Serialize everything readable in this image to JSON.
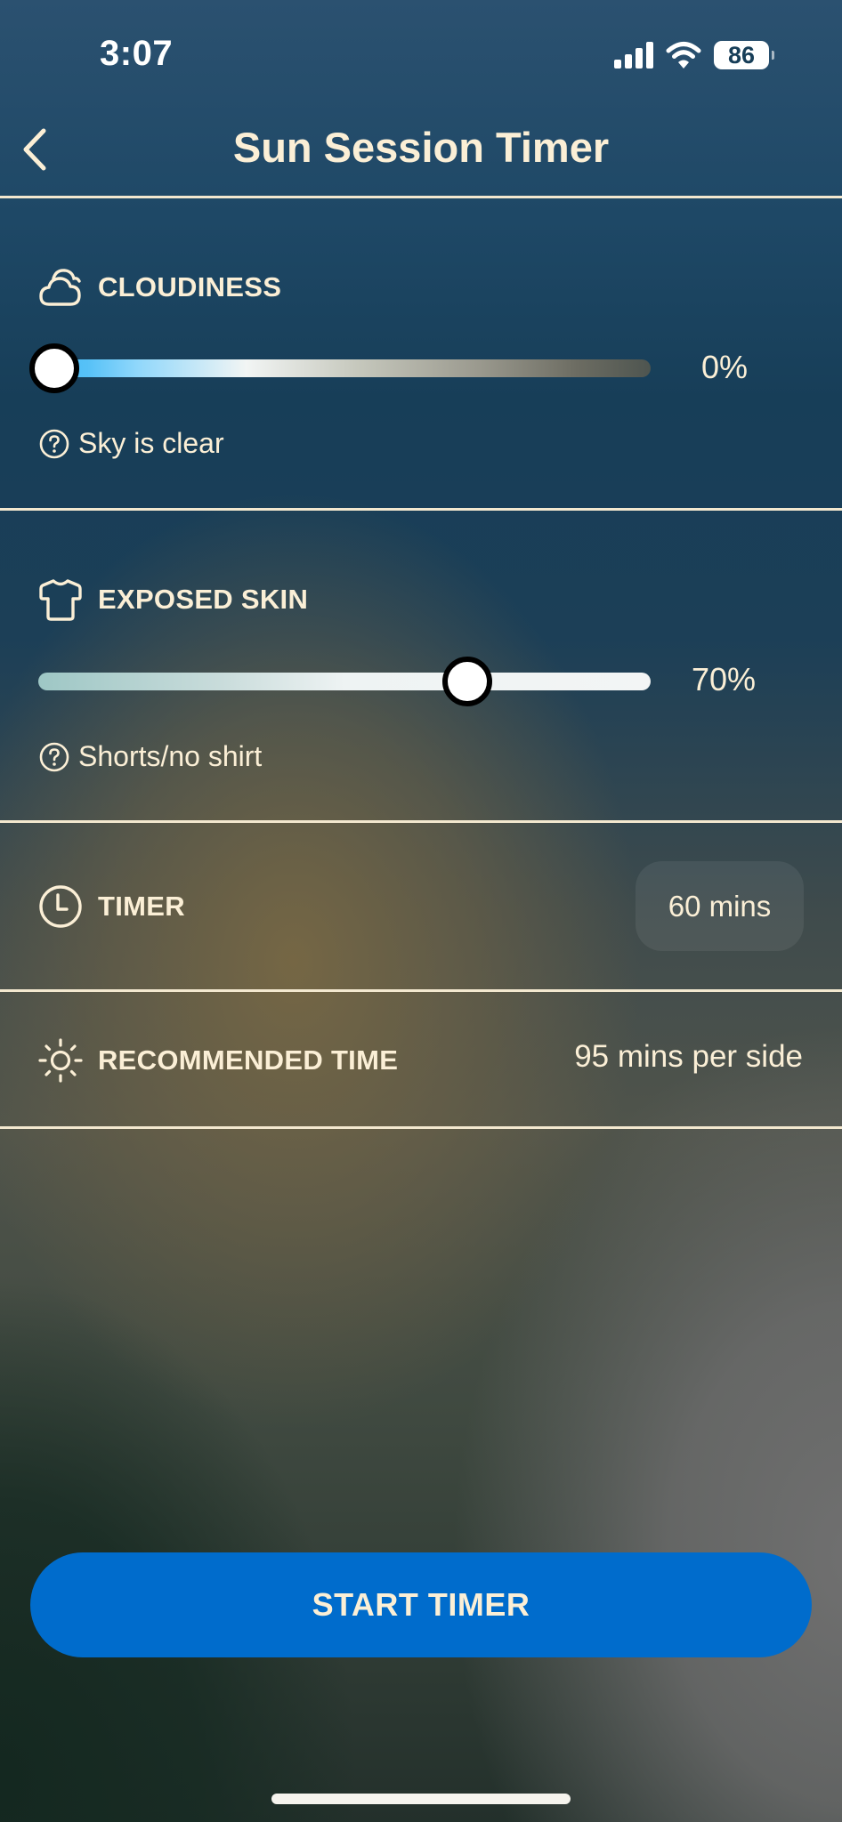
{
  "status_bar": {
    "time": "3:07",
    "battery_level": "86",
    "signal_bars": 4,
    "wifi": true
  },
  "nav": {
    "title": "Sun Session Timer",
    "back_icon": "chevron-left-icon"
  },
  "cloudiness": {
    "icon": "cloud-icon",
    "label": "CLOUDINESS",
    "value": 0,
    "value_label": "0%",
    "hint_icon": "help-circle-icon",
    "hint": "Sky is clear"
  },
  "exposed_skin": {
    "icon": "tshirt-icon",
    "label": "EXPOSED SKIN",
    "value": 70,
    "value_label": "70%",
    "hint_icon": "help-circle-icon",
    "hint": "Shorts/no shirt"
  },
  "timer": {
    "icon": "clock-icon",
    "label": "TIMER",
    "value": "60 mins"
  },
  "recommended": {
    "icon": "sun-icon",
    "label": "RECOMMENDED TIME",
    "value": "95 mins per side"
  },
  "actions": {
    "start_label": "START TIMER"
  },
  "colors": {
    "accent": "#006ccc",
    "text": "#fbefd6",
    "thumb_border": "#000000"
  }
}
